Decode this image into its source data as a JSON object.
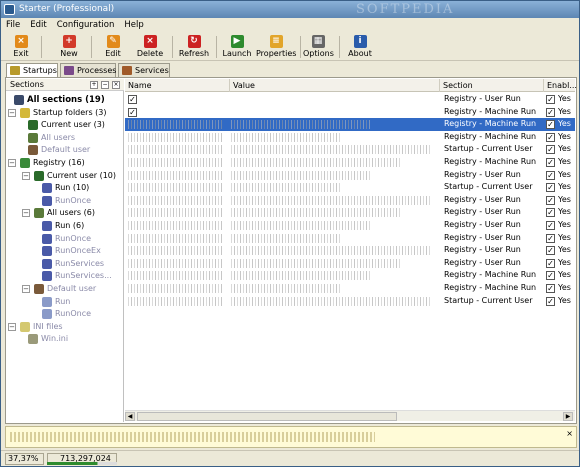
{
  "window": {
    "title": "Starter (Professional)",
    "watermark": "SOFTPEDIA"
  },
  "menu": [
    "File",
    "Edit",
    "Configuration",
    "Help"
  ],
  "toolbar": [
    {
      "label": "Exit",
      "icon": "exit-icon",
      "color": "#e28a1a"
    },
    {
      "label": "New",
      "icon": "new-icon",
      "color": "#d23a2a"
    },
    {
      "label": "Edit",
      "icon": "edit-icon",
      "color": "#e28a1a"
    },
    {
      "label": "Delete",
      "icon": "delete-icon",
      "color": "#cc2222"
    },
    {
      "label": "Refresh",
      "icon": "refresh-icon",
      "color": "#cc2222"
    },
    {
      "label": "Launch",
      "icon": "launch-icon",
      "color": "#2e8b2e"
    },
    {
      "label": "Properties",
      "icon": "properties-icon",
      "color": "#e2a52a"
    },
    {
      "label": "Options",
      "icon": "options-icon",
      "color": "#666666"
    },
    {
      "label": "About",
      "icon": "about-icon",
      "color": "#2a5cab"
    }
  ],
  "tabs": [
    "Startups",
    "Processes",
    "Services"
  ],
  "sections": {
    "header": "Sections",
    "tree": [
      {
        "label": "All sections (19)",
        "bold": true
      },
      {
        "label": "Startup folders (3)"
      },
      {
        "label": "Current user (3)"
      },
      {
        "label": "All users",
        "grey": true
      },
      {
        "label": "Default user",
        "grey": true
      },
      {
        "label": "Registry (16)"
      },
      {
        "label": "Current user (10)"
      },
      {
        "label": "Run (10)"
      },
      {
        "label": "RunOnce",
        "grey": true
      },
      {
        "label": "All users (6)"
      },
      {
        "label": "Run (6)"
      },
      {
        "label": "RunOnce",
        "grey": true
      },
      {
        "label": "RunOnceEx",
        "grey": true
      },
      {
        "label": "RunServices",
        "grey": true
      },
      {
        "label": "RunServices...",
        "grey": true
      },
      {
        "label": "Default user",
        "grey": true
      },
      {
        "label": "Run",
        "grey": true
      },
      {
        "label": "RunOnce",
        "grey": true
      },
      {
        "label": "INI files",
        "grey": true
      },
      {
        "label": "Win.ini",
        "grey": true
      }
    ]
  },
  "columns": [
    "Name",
    "Value",
    "Section",
    "Enabl..."
  ],
  "rows": [
    {
      "section": "Registry - User Run",
      "enabled": "Yes"
    },
    {
      "section": "Registry - Machine Run",
      "enabled": "Yes"
    },
    {
      "section": "Registry - Machine Run",
      "enabled": "Yes",
      "selected": true
    },
    {
      "section": "Registry - Machine Run",
      "enabled": "Yes"
    },
    {
      "section": "Startup - Current User",
      "enabled": "Yes"
    },
    {
      "section": "Registry - Machine Run",
      "enabled": "Yes"
    },
    {
      "section": "Registry - User Run",
      "enabled": "Yes"
    },
    {
      "section": "Startup - Current User",
      "enabled": "Yes"
    },
    {
      "section": "Registry - User Run",
      "enabled": "Yes"
    },
    {
      "section": "Registry - User Run",
      "enabled": "Yes"
    },
    {
      "section": "Registry - User Run",
      "enabled": "Yes"
    },
    {
      "section": "Registry - User Run",
      "enabled": "Yes"
    },
    {
      "section": "Registry - User Run",
      "enabled": "Yes"
    },
    {
      "section": "Registry - User Run",
      "enabled": "Yes"
    },
    {
      "section": "Registry - Machine Run",
      "enabled": "Yes"
    },
    {
      "section": "Registry - Machine Run",
      "enabled": "Yes"
    },
    {
      "section": "Startup - Current User",
      "enabled": "Yes"
    }
  ],
  "status": {
    "percent": "37,37%",
    "memory": "713,297,024"
  }
}
